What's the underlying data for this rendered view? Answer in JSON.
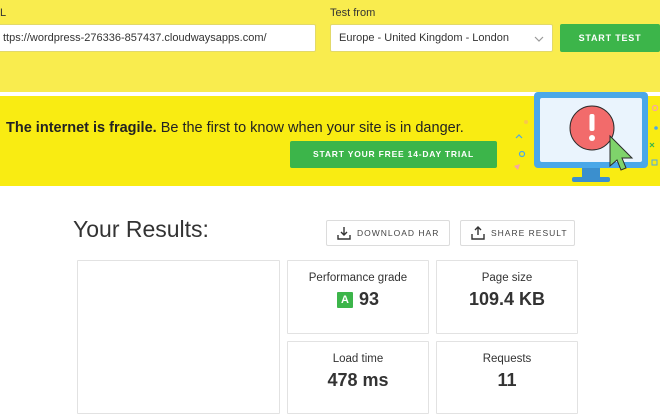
{
  "form": {
    "url_label": "L",
    "url_value": "ttps://wordpress-276336-857437.cloudwaysapps.com/",
    "test_from_label": "Test from",
    "test_from_value": "Europe - United Kingdom - London",
    "start_button": "START TEST"
  },
  "banner": {
    "headline_bold": "The internet is fragile.",
    "headline_rest": " Be the first to know when your site is in danger.",
    "trial_button": "START YOUR FREE 14-DAY TRIAL",
    "illustration_icon": "monitor-alert-icon"
  },
  "results": {
    "title": "Your Results:",
    "download_button": "DOWNLOAD HAR",
    "share_button": "SHARE RESULT",
    "performance_label": "Performance grade",
    "performance_grade": "A",
    "performance_value": "93",
    "page_size_label": "Page size",
    "page_size_value": "109.4 KB",
    "load_time_label": "Load time",
    "load_time_value": "478 ms",
    "requests_label": "Requests",
    "requests_value": "11"
  },
  "colors": {
    "header_yellow": "#f9ec4e",
    "banner_yellow": "#f9ec12",
    "accent_green": "#3cb54a",
    "alert_red": "#f26b6b",
    "monitor_blue": "#4aa8e8"
  }
}
